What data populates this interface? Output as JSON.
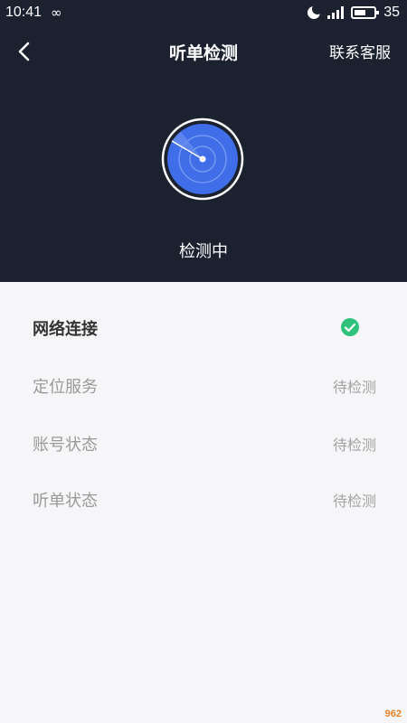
{
  "status_bar": {
    "time": "10:41",
    "loop_icon": "infinity-icon",
    "battery_level": "35"
  },
  "header": {
    "title": "听单检测",
    "back_icon": "chevron-left-icon",
    "service_label": "联系客服"
  },
  "scan": {
    "icon": "radar-icon",
    "status": "检测中"
  },
  "checks": [
    {
      "label": "网络连接",
      "state": "passed",
      "icon": "check-circle-icon"
    },
    {
      "label": "定位服务",
      "state_text": "待检测"
    },
    {
      "label": "账号状态",
      "state_text": "待检测"
    },
    {
      "label": "听单状态",
      "state_text": "待检测"
    }
  ],
  "colors": {
    "header_bg": "#1c2130",
    "radar_blue": "#3f6ee8",
    "check_green": "#2fc27d",
    "page_bg": "#f6f6f8"
  },
  "watermark": "962"
}
